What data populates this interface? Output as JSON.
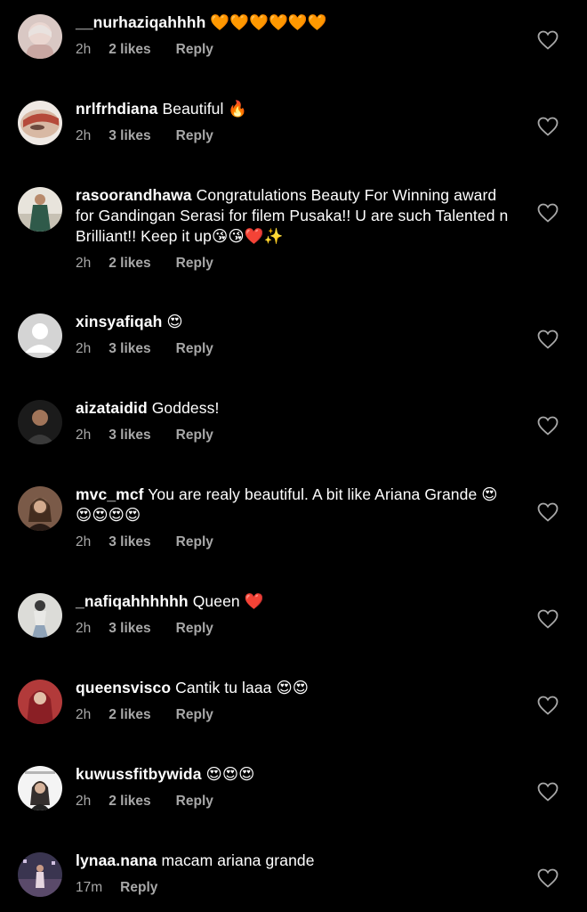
{
  "colors": {
    "background": "#000000",
    "text": "#ffffff",
    "meta": "#a8a8a8"
  },
  "comments": [
    {
      "username": "__nurhaziqahhhh",
      "text": "🧡🧡🧡🧡🧡🧡",
      "time": "2h",
      "likes": "2 likes",
      "reply": "Reply",
      "avatar_icon": "profile-photo"
    },
    {
      "username": "nrlfrhdiana",
      "text": "Beautiful 🔥",
      "time": "2h",
      "likes": "3 likes",
      "reply": "Reply",
      "avatar_icon": "profile-photo"
    },
    {
      "username": "rasoorandhawa",
      "text": "Congratulations Beauty For Winning award for Gandingan Serasi for filem Pusaka!! U are such Talented n Brilliant!! Keep it up😘😘❤️✨",
      "time": "2h",
      "likes": "2 likes",
      "reply": "Reply",
      "avatar_icon": "profile-photo"
    },
    {
      "username": "xinsyafiqah",
      "text": "😍",
      "time": "2h",
      "likes": "3 likes",
      "reply": "Reply",
      "avatar_icon": "default-avatar"
    },
    {
      "username": "aizataidid",
      "text": "Goddess!",
      "time": "2h",
      "likes": "3 likes",
      "reply": "Reply",
      "avatar_icon": "profile-photo"
    },
    {
      "username": "mvc_mcf",
      "text": "You are realy beautiful. A bit like Ariana Grande 😍😍😍😍😍",
      "time": "2h",
      "likes": "3 likes",
      "reply": "Reply",
      "avatar_icon": "profile-photo"
    },
    {
      "username": "_nafiqahhhhhh",
      "text": "Queen ❤️",
      "time": "2h",
      "likes": "3 likes",
      "reply": "Reply",
      "avatar_icon": "profile-photo"
    },
    {
      "username": "queensvisco",
      "text": "Cantik tu laaa 😍😍",
      "time": "2h",
      "likes": "2 likes",
      "reply": "Reply",
      "avatar_icon": "profile-photo"
    },
    {
      "username": "kuwussfitbywida",
      "text": "😍😍😍",
      "time": "2h",
      "likes": "2 likes",
      "reply": "Reply",
      "avatar_icon": "profile-photo"
    },
    {
      "username": "lynaa.nana",
      "text": "macam ariana grande",
      "time": "17m",
      "likes": "",
      "reply": "Reply",
      "avatar_icon": "profile-photo"
    }
  ]
}
